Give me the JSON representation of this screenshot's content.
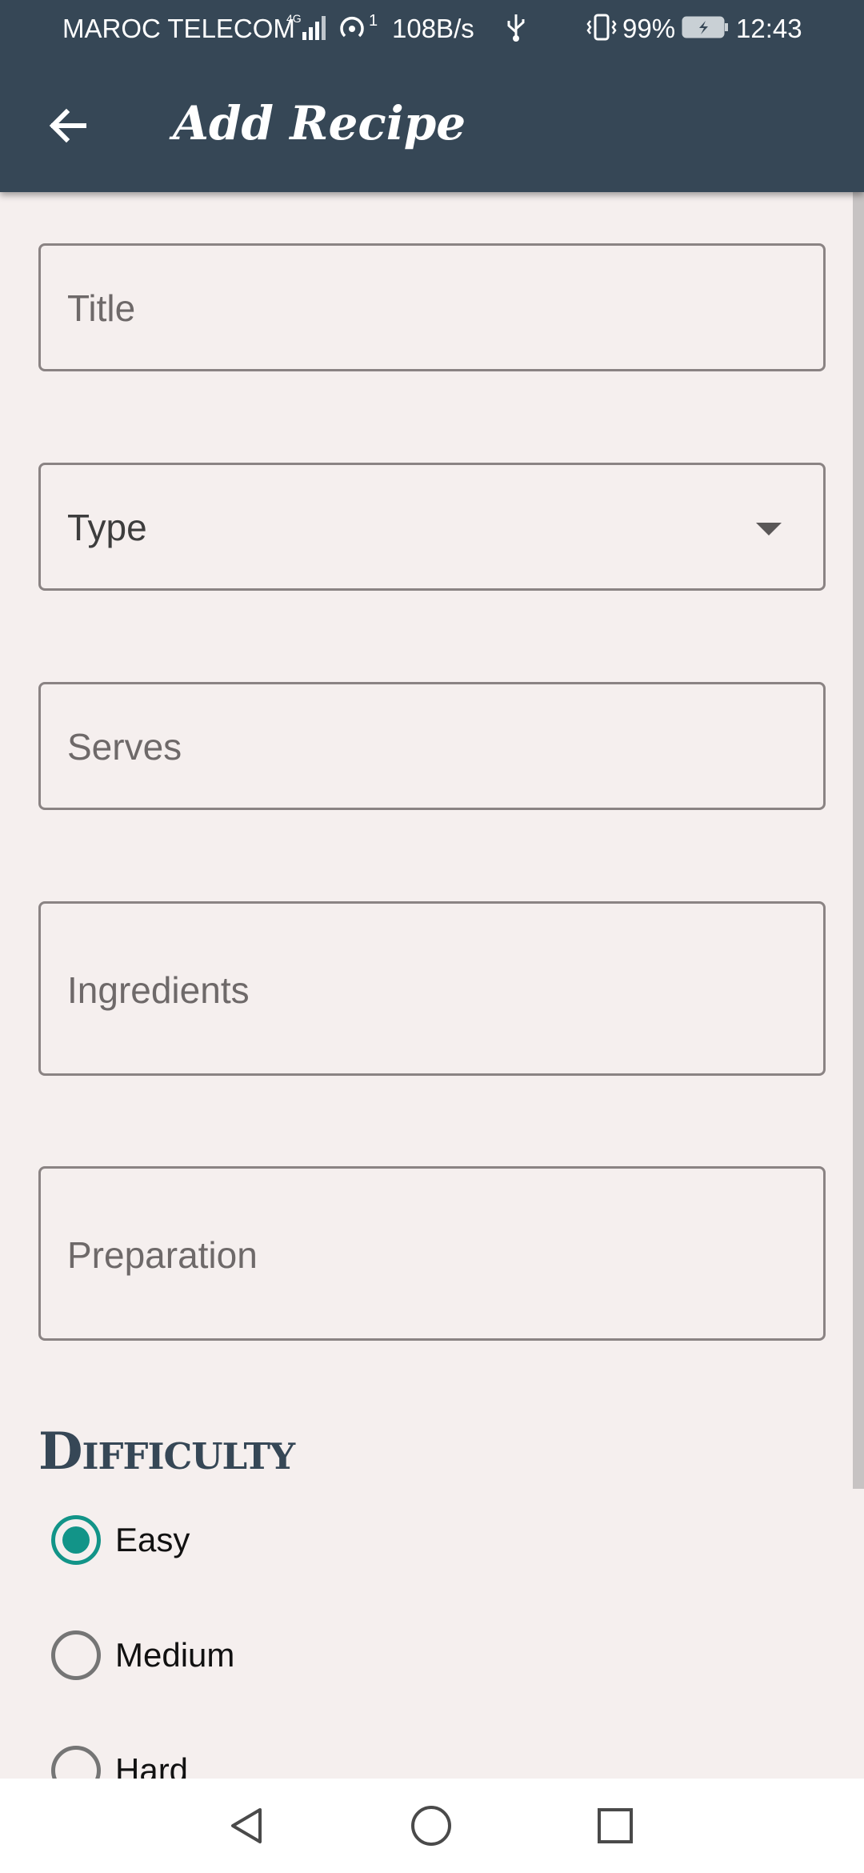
{
  "status_bar": {
    "carrier": "MAROC TELECOM",
    "network": "4G",
    "hotspot_count": "1",
    "speed": "108B/s",
    "battery_percent": "99%",
    "time": "12:43"
  },
  "app_bar": {
    "title": "Add Recipe",
    "back_icon": "arrow-left-icon"
  },
  "form": {
    "title_label": "Title",
    "type_label": "Type",
    "serves_label": "Serves",
    "ingredients_label": "Ingredients",
    "preparation_label": "Preparation"
  },
  "difficulty": {
    "heading": "Difficulty",
    "options": [
      {
        "label": "Easy",
        "selected": true
      },
      {
        "label": "Medium",
        "selected": false
      },
      {
        "label": "Hard",
        "selected": false
      }
    ]
  },
  "colors": {
    "app_bar": "#364756",
    "accent": "#129488",
    "background": "#f5efee"
  },
  "nav_bar": {
    "icons": [
      "triangle-back-icon",
      "circle-home-icon",
      "square-recent-icon"
    ]
  }
}
